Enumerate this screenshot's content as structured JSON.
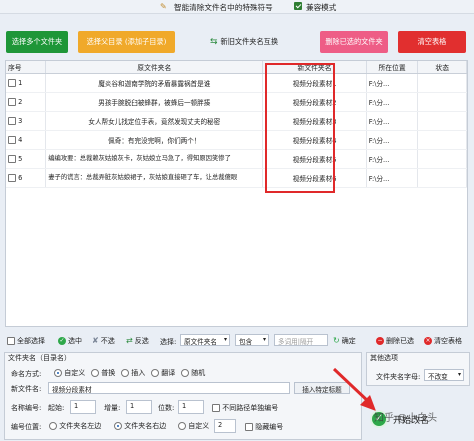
{
  "titlebar": {
    "title": "智能清除文件名中的特殊符号",
    "compat_label": "兼容模式"
  },
  "toolbar": {
    "select_folders": {
      "label": "选择多个文件夹",
      "color": "#1e9638"
    },
    "select_parent": {
      "label": "选择父目录 (添加子目录)",
      "color": "#f0a92a"
    },
    "restore": {
      "label": "新旧文件夹名互换"
    },
    "delete_selected": {
      "label": "删除已选的文件夹",
      "color": "#ee5d86"
    },
    "clear_table": {
      "label": "清空表格",
      "color": "#e12f2f"
    }
  },
  "table": {
    "headers": [
      "序号",
      "原文件夹名",
      "新文件夹名",
      "所在位置",
      "状态"
    ],
    "rows": [
      {
        "num": "1",
        "orig": "魔炎谷和迦南学院的矛盾暴露祸首是谁",
        "new": "视频分段素材1",
        "loc": "F:\\分..."
      },
      {
        "num": "2",
        "orig": "男孩手腕脱臼被蜂群，被蜂后一顿胖揍",
        "new": "视频分段素材2",
        "loc": "F:\\分..."
      },
      {
        "num": "3",
        "orig": "女人帮女儿找定位手表，竟然发现丈夫的秘密",
        "new": "视频分段素材3",
        "loc": "F:\\分..."
      },
      {
        "num": "4",
        "orig": "佩奇：有完没完啊，你们两个！",
        "new": "视频分段素材4",
        "loc": "F:\\分..."
      },
      {
        "num": "5",
        "orig": "编编攻要：总裁赖灰姑娘灰卡，灰姑娘立马急了，得知原因笑惨了",
        "orig2": "因笑惨了",
        "new": "视频分段素材5",
        "loc": "F:\\分..."
      },
      {
        "num": "6",
        "orig": "妻子的谎言：总裁弄脏灰姑娘裙子，灰姑娘直接砸了车，让总裁傻眼",
        "orig2": "总裁傻眼",
        "new": "视频分段素材6",
        "loc": "F:\\分..."
      }
    ]
  },
  "filterbar": {
    "select_all": "全部选择",
    "check": "选中",
    "uncheck": "不选",
    "invert": "反选",
    "select_label": "选择:",
    "field_select": "原文件夹名",
    "mode_select": "包含",
    "keyword_placeholder": "多词用|隔开",
    "confirm": "确定",
    "delete_selected": "删除已选",
    "clear_table": "清空表格"
  },
  "naming": {
    "group_title": "文件夹名（目录名）",
    "method_label": "命名方式:",
    "methods": [
      "自定义",
      "普换",
      "插入",
      "翻译",
      "随机"
    ],
    "selected_method": "自定义",
    "newname_label": "新文件名:",
    "newname_value": "视频分段素材",
    "insert_special": "插入特定标题",
    "numbering_label": "名称编号:",
    "start_label": "起始:",
    "start_value": "1",
    "step_label": "增量:",
    "step_value": "1",
    "digits_label": "位数:",
    "digits_value": "1",
    "no_path_label": "不同路径单独编号",
    "position_label": "编号位置:",
    "position_options": [
      "文件夹名左边",
      "文件夹名右边",
      "自定义"
    ],
    "selected_position": "文件夹名右边",
    "custom_value": "2",
    "hide_label": "隐藏编号"
  },
  "other": {
    "group_title": "其他选项",
    "case_label": "文件夹名字母:",
    "case_value": "不改变"
  },
  "start": {
    "label": "开始改名",
    "color": "#2ea84a"
  },
  "watermark": "知乎 @小白头"
}
